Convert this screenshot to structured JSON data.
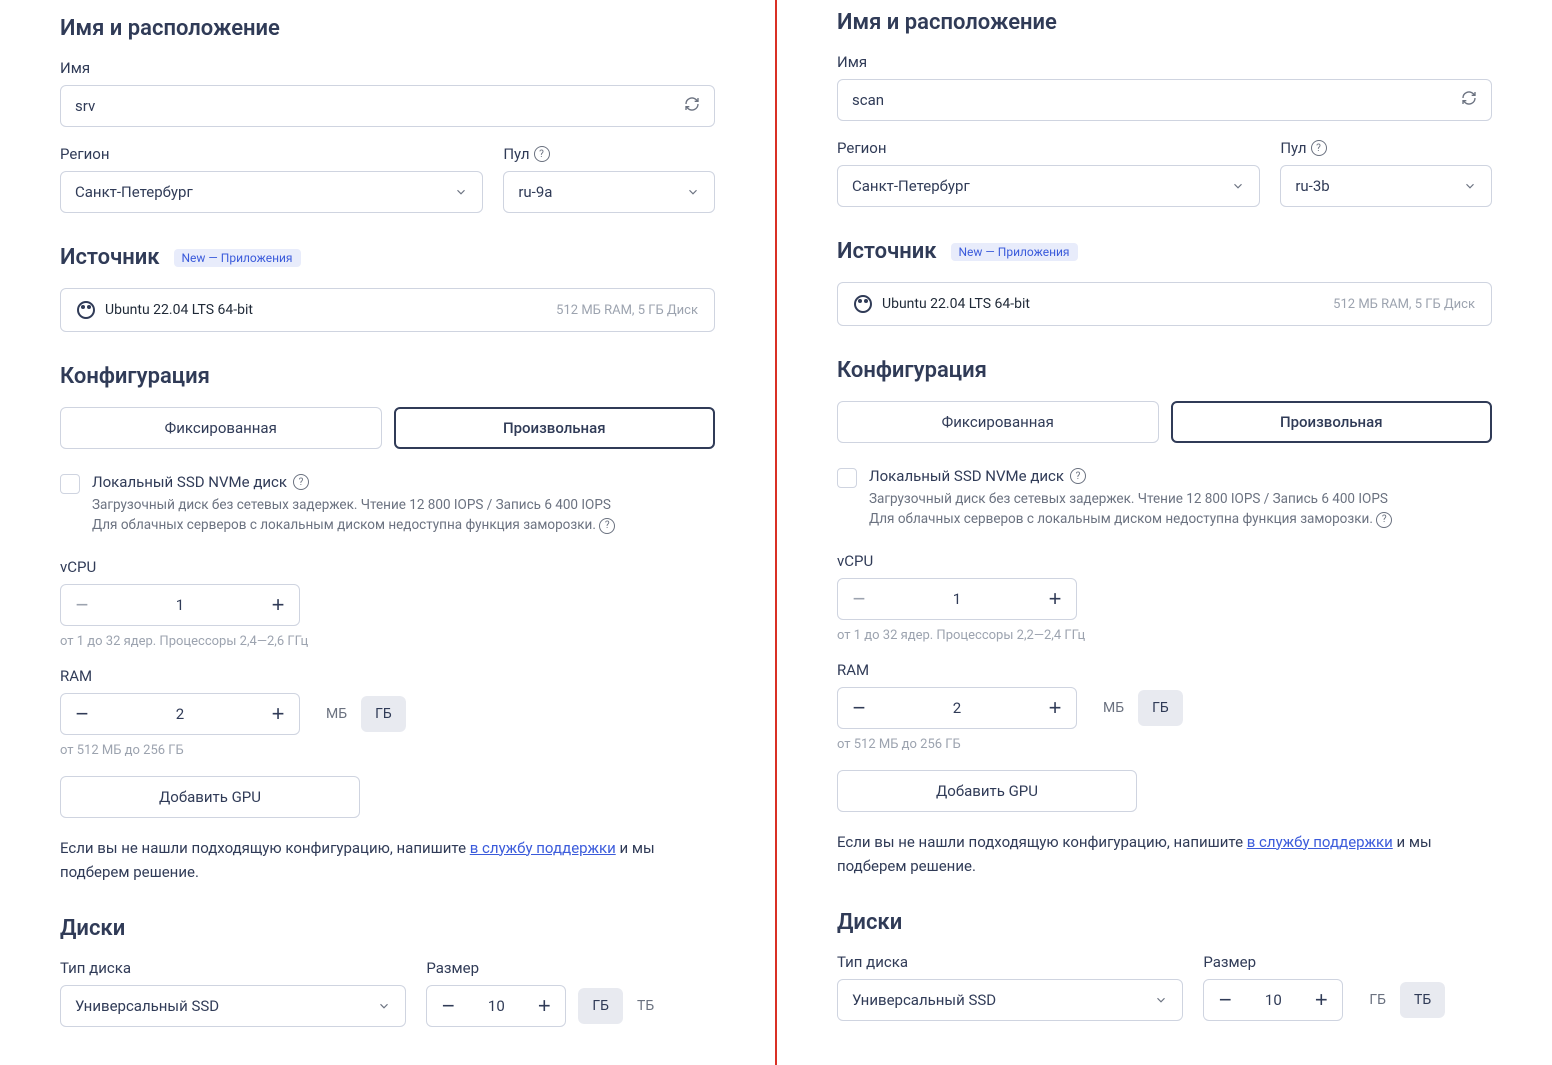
{
  "left": {
    "section_name_location": "Имя и расположение",
    "name_label": "Имя",
    "name_value": "srv",
    "region_label": "Регион",
    "region_value": "Санкт-Петербург",
    "pool_label": "Пул",
    "pool_value": "ru-9a",
    "source_label": "Источник",
    "source_badge": "New — Приложения",
    "source_os": "Ubuntu 22.04 LTS 64-bit",
    "source_req": "512 МБ RAM, 5 ГБ Диск",
    "config_label": "Конфигурация",
    "config_fixed": "Фиксированная",
    "config_custom": "Произвольная",
    "ssd_title": "Локальный SSD NVMe диск",
    "ssd_desc1": "Загрузочный диск без сетевых задержек. Чтение 12 800 IOPS / Запись 6 400 IOPS",
    "ssd_desc2": "Для облачных серверов с локальным диском недоступна функция заморозки.",
    "vcpu_label": "vCPU",
    "vcpu_value": "1",
    "vcpu_hint": "от 1 до 32 ядер. Процессоры 2,4—2,6 ГГц",
    "ram_label": "RAM",
    "ram_value": "2",
    "ram_unit_mb": "МБ",
    "ram_unit_gb": "ГБ",
    "ram_hint": "от 512 МБ до 256 ГБ",
    "add_gpu": "Добавить GPU",
    "support_pre": "Если вы не нашли подходящую конфигурацию, напишите ",
    "support_link": "в службу поддержки",
    "support_post": " и мы подберем решение.",
    "disks_label": "Диски",
    "disk_type_label": "Тип диска",
    "disk_type_value": "Универсальный SSD",
    "size_label": "Размер",
    "size_value": "10",
    "size_gb": "ГБ",
    "size_tb": "ТБ"
  },
  "right": {
    "section_name_location": "Имя и расположение",
    "name_label": "Имя",
    "name_value": "scan",
    "region_label": "Регион",
    "region_value": "Санкт-Петербург",
    "pool_label": "Пул",
    "pool_value": "ru-3b",
    "source_label": "Источник",
    "source_badge": "New — Приложения",
    "source_os": "Ubuntu 22.04 LTS 64-bit",
    "source_req": "512 МБ RAM, 5 ГБ Диск",
    "config_label": "Конфигурация",
    "config_fixed": "Фиксированная",
    "config_custom": "Произвольная",
    "ssd_title": "Локальный SSD NVMe диск",
    "ssd_desc1": "Загрузочный диск без сетевых задержек. Чтение 12 800 IOPS / Запись 6 400 IOPS",
    "ssd_desc2": "Для облачных серверов с локальным диском недоступна функция заморозки.",
    "vcpu_label": "vCPU",
    "vcpu_value": "1",
    "vcpu_hint": "от 1 до 32 ядер. Процессоры 2,2—2,4 ГГц",
    "ram_label": "RAM",
    "ram_value": "2",
    "ram_unit_mb": "МБ",
    "ram_unit_gb": "ГБ",
    "ram_hint": "от 512 МБ до 256 ГБ",
    "add_gpu": "Добавить GPU",
    "support_pre": "Если вы не нашли подходящую конфигурацию, напишите ",
    "support_link": "в службу поддержки",
    "support_post": " и мы подберем решение.",
    "disks_label": "Диски",
    "disk_type_label": "Тип диска",
    "disk_type_value": "Универсальный SSD",
    "size_label": "Размер",
    "size_value": "10",
    "size_gb": "ГБ",
    "size_tb": "ТБ"
  }
}
